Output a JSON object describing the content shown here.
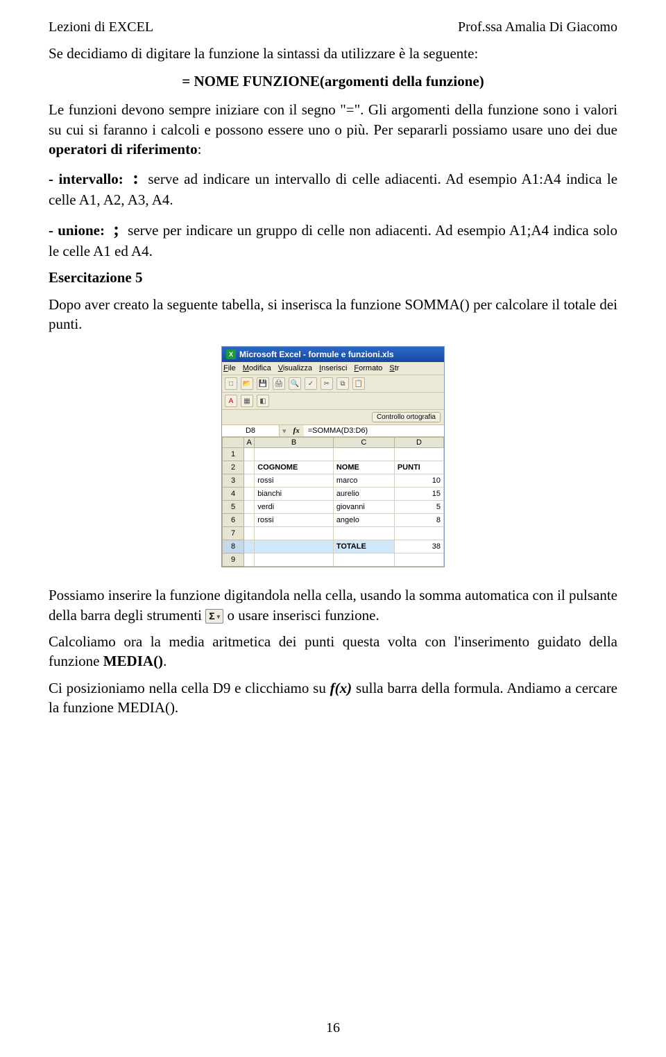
{
  "header": {
    "left": "Lezioni di EXCEL",
    "right": "Prof.ssa Amalia Di Giacomo"
  },
  "intro": {
    "p1": "Se decidiamo di digitare la funzione la sintassi da utilizzare è la seguente:",
    "syntax": "= NOME FUNZIONE(argomenti della funzione)",
    "p2": "Le funzioni devono sempre iniziare con il segno \"=\". Gli argomenti della funzione sono i valori su cui si faranno i calcoli e possono essere uno o più. Per separarli possiamo usare uno dei due ",
    "p2_bold": "operatori di riferimento",
    "p2_tail": ":",
    "intervallo_label": "- intervallo:",
    "intervallo_symbol": ":",
    "intervallo_text": " serve ad indicare un intervallo di celle adiacenti. Ad esempio A1:A4 indica le celle A1, A2, A3, A4.",
    "unione_label": "- unione:",
    "unione_symbol": ";",
    "unione_text": " serve per indicare un gruppo di celle non adiacenti. Ad esempio A1;A4 indica solo le celle A1 ed A4.",
    "ex5_title": "Esercitazione 5",
    "ex5_text": "Dopo aver creato la seguente tabella, si inserisca la funzione SOMMA() per calcolare il totale dei punti."
  },
  "excel": {
    "title": "Microsoft Excel - formule e funzioni.xls",
    "menu": [
      "File",
      "Modifica",
      "Visualizza",
      "Inserisci",
      "Formato",
      "Str"
    ],
    "ortografia": "Controllo ortografia",
    "name_box": "D8",
    "fx": "fx",
    "formula": "=SOMMA(D3:D6)",
    "cols": [
      "A",
      "B",
      "C",
      "D"
    ],
    "rows": {
      "2": {
        "B": "COGNOME",
        "C": "NOME",
        "D": "PUNTI"
      },
      "3": {
        "B": "rossi",
        "C": "marco",
        "D": "10"
      },
      "4": {
        "B": "bianchi",
        "C": "aurelio",
        "D": "15"
      },
      "5": {
        "B": "verdi",
        "C": "giovanni",
        "D": "5"
      },
      "6": {
        "B": "rossi",
        "C": "angelo",
        "D": "8"
      },
      "8_C": "TOTALE",
      "8_D": "38"
    }
  },
  "after": {
    "p1_a": "Possiamo inserire la funzione digitandola nella cella, usando la somma automatica con il pulsante della barra degli strumenti ",
    "sigma": "Σ",
    "p1_b": " o usare inserisci funzione.",
    "p2_a": "Calcoliamo ora la media aritmetica dei punti questa volta con l'inserimento guidato della funzione ",
    "p2_bold": "MEDIA()",
    "p2_tail": ".",
    "p3_a": "Ci posizioniamo nella cella D9 e clicchiamo su ",
    "p3_italic": "f(x)",
    "p3_b": " sulla barra della formula. Andiamo a cercare la funzione MEDIA()."
  },
  "page_number": "16"
}
